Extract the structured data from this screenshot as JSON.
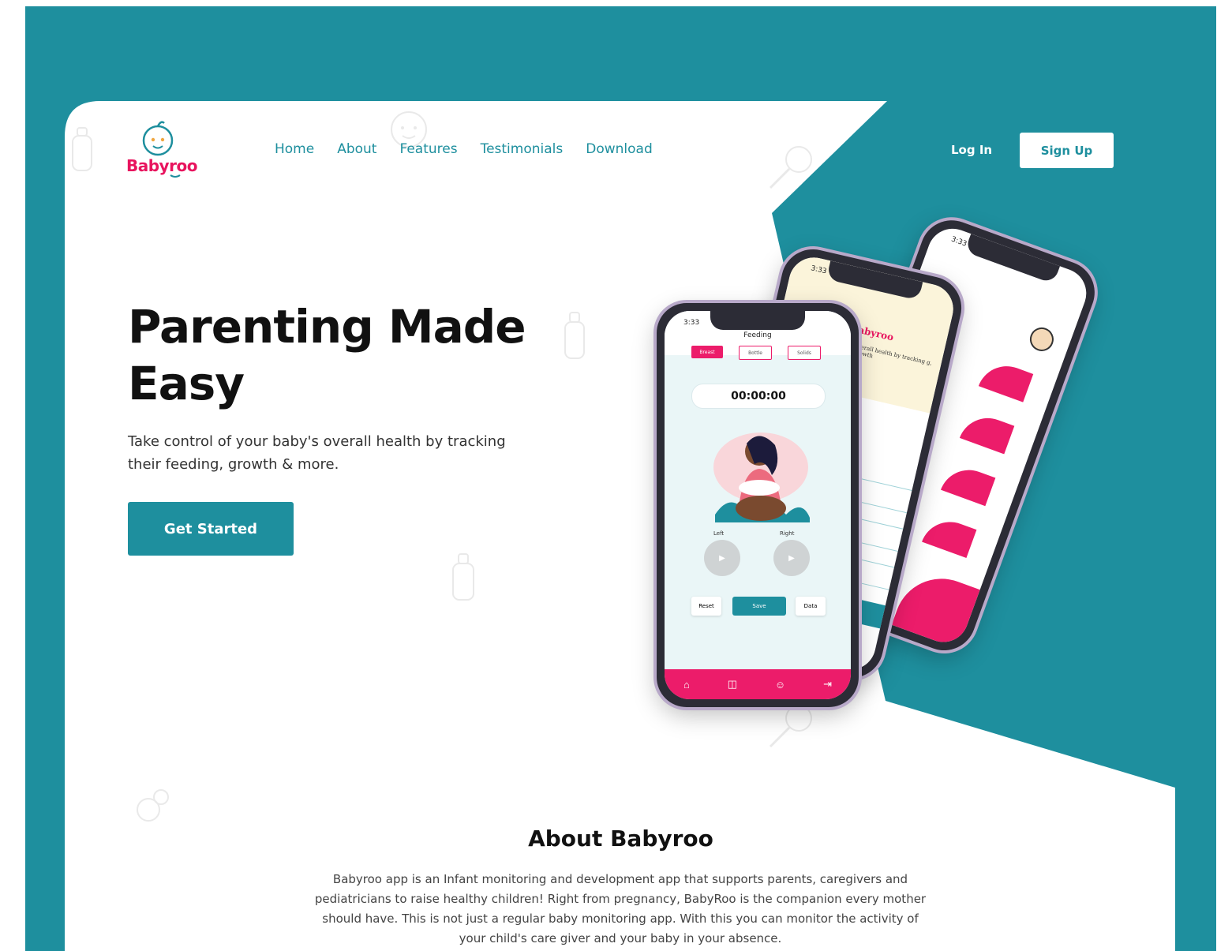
{
  "brand": {
    "name": "Babyroo",
    "primary_color": "#1e8f9e",
    "accent_color": "#e8145e"
  },
  "nav": {
    "items": [
      {
        "label": "Home"
      },
      {
        "label": "About"
      },
      {
        "label": "Features"
      },
      {
        "label": "Testimonials"
      },
      {
        "label": "Download"
      }
    ]
  },
  "auth": {
    "login_label": "Log In",
    "signup_label": "Sign Up"
  },
  "hero": {
    "headline": "Parenting Made Easy",
    "subtext": "Take control of your baby's overall health by tracking their feeding, growth & more.",
    "cta_label": "Get Started"
  },
  "phone_main": {
    "status_time": "3:33",
    "title": "Feeding",
    "tabs": [
      "Breast",
      "Bottle",
      "Solids"
    ],
    "active_tab": "Breast",
    "timer": "00:00:00",
    "left_label": "Left",
    "right_label": "Right",
    "buttons": {
      "reset": "Reset",
      "save": "Save",
      "data": "Data"
    },
    "bottom_nav_icons": [
      "home-icon",
      "gallery-icon",
      "baby-icon",
      "logout-icon"
    ]
  },
  "phone_middle": {
    "status_time": "3:33",
    "logo_text": "Babyroo",
    "header_text": "overall health by tracking g, growth"
  },
  "phone_back": {
    "status_time": "3:33"
  },
  "about": {
    "title": "About Babyroo",
    "text": "Babyroo app is an Infant monitoring and development app that supports parents, caregivers and pediatricians to raise healthy children! Right from pregnancy, BabyRoo is the companion every mother should have. This is not just a regular baby monitoring app. With this you can monitor the activity of your child's care giver and your baby in your absence."
  }
}
